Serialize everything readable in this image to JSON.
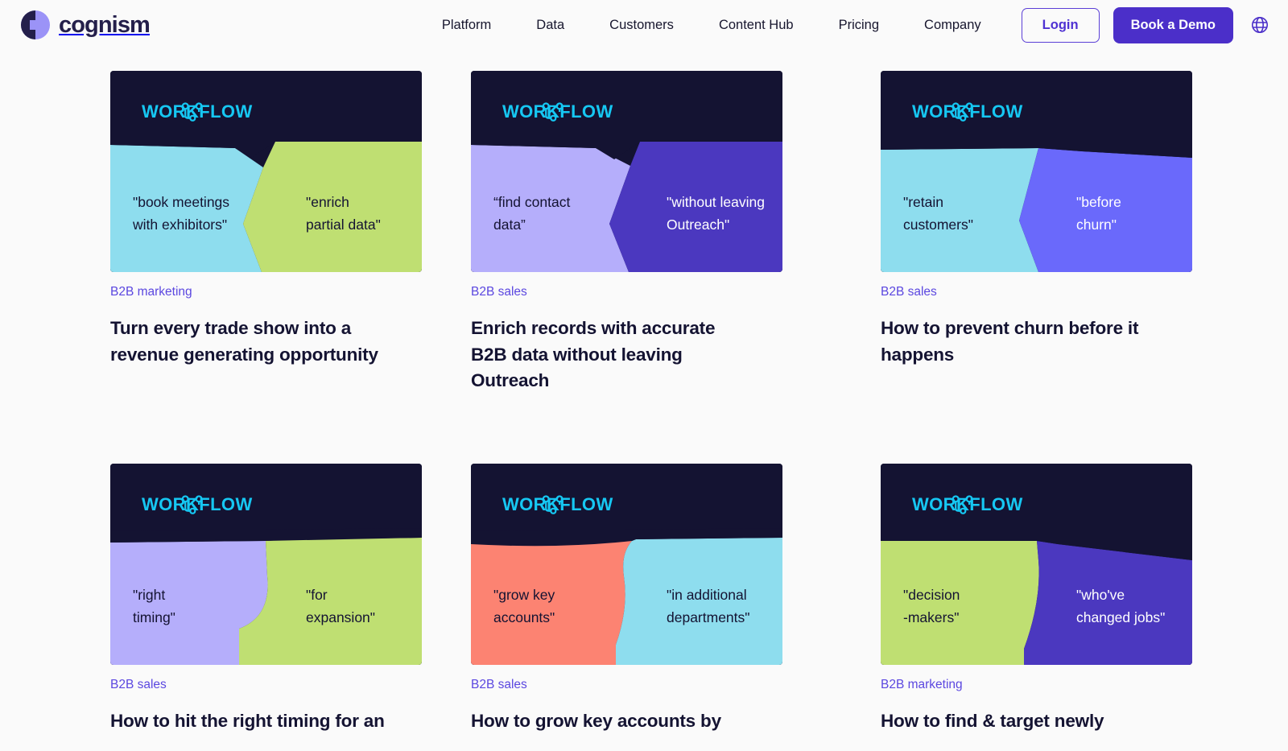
{
  "brand": {
    "name": "cognism",
    "logo_icon": "cognism-circle-logo"
  },
  "nav": {
    "links": [
      {
        "label": "Platform"
      },
      {
        "label": "Data"
      },
      {
        "label": "Customers"
      },
      {
        "label": "Content Hub"
      },
      {
        "label": "Pricing"
      },
      {
        "label": "Company"
      }
    ],
    "login_label": "Login",
    "demo_label": "Book a Demo",
    "language_icon": "globe-icon"
  },
  "colors": {
    "page_background": "#FAFAFA",
    "brand_navy": "#241F4B",
    "card_dark": "#141332",
    "accent_purple": "#4B2FC9",
    "category_purple": "#5B47E0",
    "workflow_cyan": "#16C7F2",
    "light_cyan": "#8EDDEE",
    "lime_green": "#BFDF72",
    "lavender": "#B5AEFB",
    "deep_purple": "#4B38BF",
    "bright_purple": "#6A69FB",
    "coral": "#FC8372"
  },
  "cards": [
    {
      "tag": "WORKFLOW",
      "tag_icon": "workflow-node-icon",
      "left_quote": "\"book meetings\nwith exhibitors\"",
      "right_quote": "\"enrich\npartial data\"",
      "left_color": "#8EDDEE",
      "right_color": "#BFDF72",
      "left_text_color": "dark",
      "right_text_color": "dark",
      "category": "B2B marketing",
      "title": "Turn every trade show into a\nrevenue generating opportunity"
    },
    {
      "tag": "WORKFLOW",
      "tag_icon": "workflow-node-icon",
      "left_quote": "“find contact\ndata”",
      "right_quote": "\"without leaving\nOutreach\"",
      "left_color": "#B5AEFB",
      "right_color": "#4B38BF",
      "left_text_color": "dark",
      "right_text_color": "light",
      "category": "B2B sales",
      "title": "Enrich records with accurate\nB2B data without leaving\nOutreach"
    },
    {
      "tag": "WORKFLOW",
      "tag_icon": "workflow-node-icon",
      "left_quote": "\"retain\ncustomers\"",
      "right_quote": "\"before\nchurn\"",
      "left_color": "#8EDDEE",
      "right_color": "#6A69FB",
      "left_text_color": "dark",
      "right_text_color": "light",
      "category": "B2B sales",
      "title": "How to prevent churn before it\nhappens"
    },
    {
      "tag": "WORKFLOW",
      "tag_icon": "workflow-node-icon",
      "left_quote": "\"right\ntiming\"",
      "right_quote": "\"for\nexpansion\"",
      "left_color": "#B5AEFB",
      "right_color": "#BFDF72",
      "left_text_color": "dark",
      "right_text_color": "dark",
      "category": "B2B sales",
      "title": "How to hit the right timing for an"
    },
    {
      "tag": "WORKFLOW",
      "tag_icon": "workflow-node-icon",
      "left_quote": "\"grow key\naccounts\"",
      "right_quote": "\"in additional\ndepartments\"",
      "left_color": "#FC8372",
      "right_color": "#8EDDEE",
      "left_text_color": "dark",
      "right_text_color": "dark",
      "category": "B2B sales",
      "title": "How to grow key accounts by"
    },
    {
      "tag": "WORKFLOW",
      "tag_icon": "workflow-node-icon",
      "left_quote": "\"decision\n-makers\"",
      "right_quote": "\"who've\nchanged jobs\"",
      "left_color": "#BFDF72",
      "right_color": "#4B38BF",
      "left_text_color": "dark",
      "right_text_color": "light",
      "category": "B2B marketing",
      "title": "How to find & target newly"
    }
  ]
}
